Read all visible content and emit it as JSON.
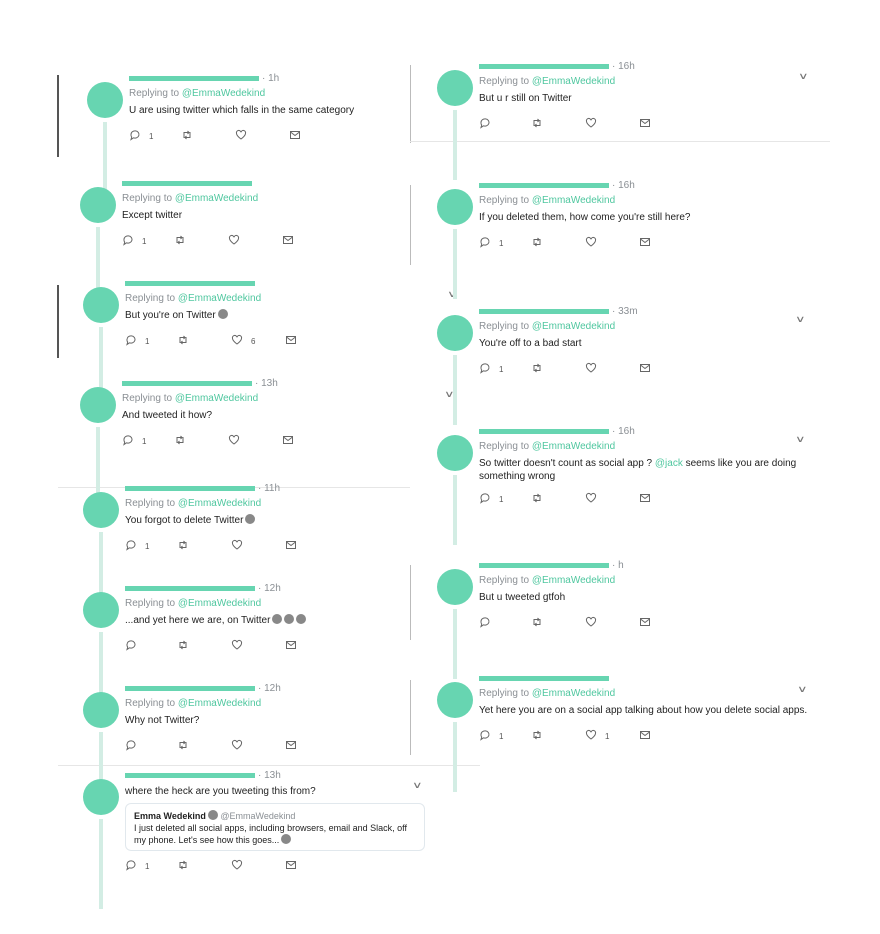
{
  "reply_prefix": "Replying to ",
  "reply_to": "@EmmaWedekind",
  "tweets": [
    {
      "time": "1h",
      "text": "U are using twitter which falls in the same category",
      "replies": "1",
      "likes": ""
    },
    {
      "time": "",
      "text": "Except twitter",
      "replies": "1",
      "likes": ""
    },
    {
      "time": "",
      "text": "But you're on Twitter",
      "emoji": 1,
      "replies": "1",
      "likes": "6"
    },
    {
      "time": "13h",
      "text": "And tweeted it how?",
      "replies": "1",
      "likes": ""
    },
    {
      "time": "11h",
      "text": "You forgot to delete Twitter",
      "emoji": 1,
      "replies": "1",
      "likes": ""
    },
    {
      "time": "12h",
      "text": "...and yet here we are, on Twitter",
      "emoji": 3,
      "replies": "",
      "likes": ""
    },
    {
      "time": "12h",
      "text": "Why not Twitter?",
      "replies": "",
      "likes": ""
    },
    {
      "time": "13h",
      "text": "where the heck are you tweeting this from?",
      "replies": "1",
      "likes": "",
      "no_reply_line": true,
      "quote": {
        "name": "Emma Wedekind",
        "handle": "@EmmaWedekind",
        "text": "I just deleted all social apps, including browsers, email and Slack, off my phone. Let's see how this goes..."
      }
    },
    {
      "time": "16h",
      "text": "But u r still on Twitter",
      "replies": "",
      "likes": ""
    },
    {
      "time": "16h",
      "text": "If you deleted them, how come you're still here?",
      "replies": "1",
      "likes": ""
    },
    {
      "time": "33m",
      "text": "You're off to a bad start",
      "replies": "1",
      "likes": ""
    },
    {
      "time": "16h",
      "text": "So twitter doesn't count as social app ? ",
      "mention": "@jack",
      "text2": " seems like you are doing something wrong",
      "replies": "1",
      "likes": ""
    },
    {
      "time": "h",
      "text": "But u tweeted gtfoh",
      "replies": "",
      "likes": ""
    },
    {
      "time": "",
      "text": "Yet here you are on a social app talking about how you delete social apps.",
      "replies": "1",
      "likes": "1"
    }
  ],
  "colors": {
    "avatar": "#67d5b1",
    "mention": "#4fc79f"
  }
}
